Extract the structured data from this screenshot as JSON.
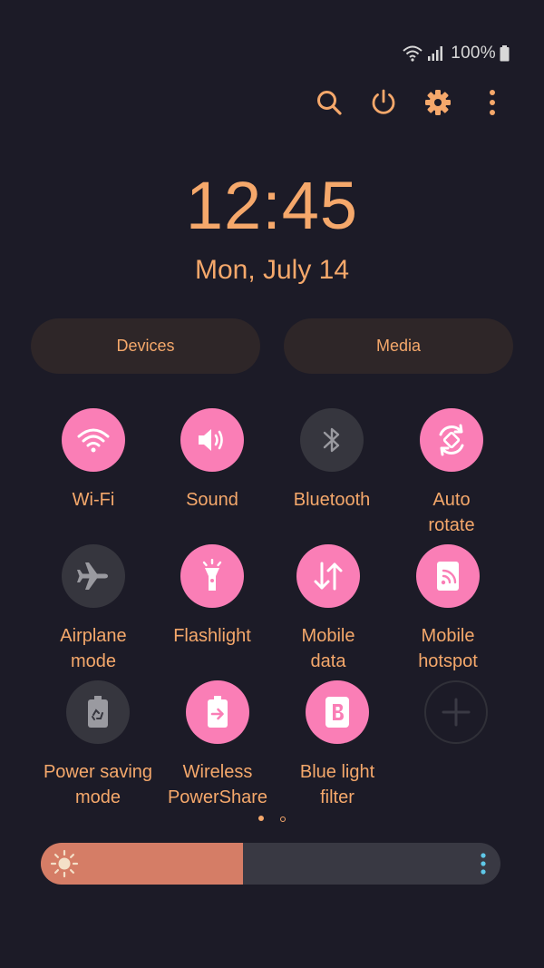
{
  "status": {
    "battery": "100%",
    "icons": [
      "wifi-icon",
      "signal-icon",
      "battery-icon"
    ]
  },
  "actions": {
    "icons": [
      "search-icon",
      "power-icon",
      "settings-icon",
      "more-vert-icon"
    ]
  },
  "clock": {
    "time": "12:45",
    "date": "Mon, July 14"
  },
  "buttons": {
    "devices": "Devices",
    "media": "Media"
  },
  "tiles": [
    {
      "label": "Wi-Fi",
      "state": "on",
      "icon": "wifi-icon"
    },
    {
      "label": "Sound",
      "state": "on",
      "icon": "sound-icon"
    },
    {
      "label": "Bluetooth",
      "state": "off",
      "icon": "bluetooth-icon"
    },
    {
      "label": "Auto\nrotate",
      "state": "on",
      "icon": "auto-rotate-icon"
    },
    {
      "label": "Airplane\nmode",
      "state": "off",
      "icon": "airplane-icon"
    },
    {
      "label": "Flashlight",
      "state": "on",
      "icon": "flashlight-icon"
    },
    {
      "label": "Mobile\ndata",
      "state": "on",
      "icon": "mobile-data-icon"
    },
    {
      "label": "Mobile\nhotspot",
      "state": "on",
      "icon": "hotspot-icon"
    },
    {
      "label": "Power saving\nmode",
      "state": "off",
      "icon": "power-saving-icon"
    },
    {
      "label": "Wireless\nPowerShare",
      "state": "on",
      "icon": "wireless-powershare-icon"
    },
    {
      "label": "Blue light\nfilter",
      "state": "on",
      "icon": "blue-light-filter-icon"
    }
  ],
  "pager": {
    "pages": 2,
    "current": 1
  },
  "brightness": {
    "level": 0.44
  },
  "colors": {
    "accent": "#f5a86b",
    "tile_on": "#fa7eb6",
    "tile_off": "#36363e",
    "background": "#1c1b27",
    "brightness_fill": "#d57d66"
  }
}
